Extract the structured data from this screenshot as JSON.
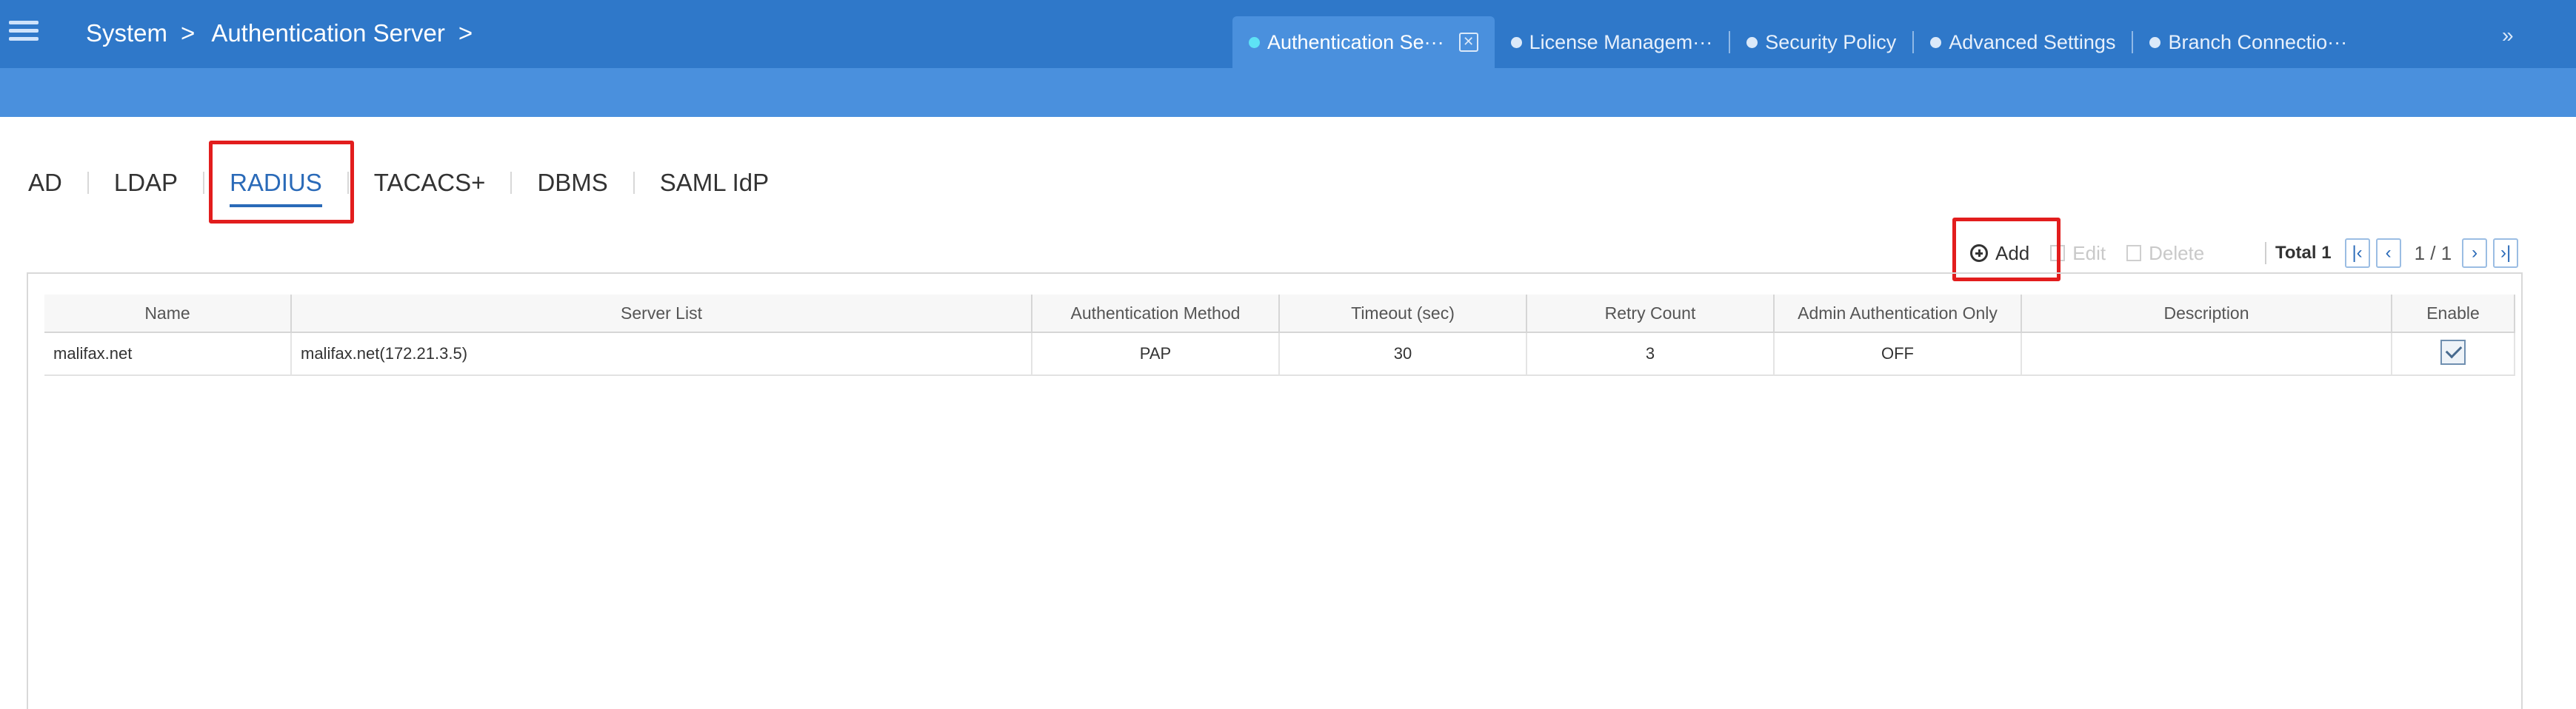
{
  "header": {
    "breadcrumb": [
      "System",
      ">",
      "Authentication Server",
      ">"
    ],
    "tabs": [
      {
        "label": "Authentication Se···",
        "active": true
      },
      {
        "label": "License Managem···",
        "active": false
      },
      {
        "label": "Security Policy",
        "active": false
      },
      {
        "label": "Advanced Settings",
        "active": false
      },
      {
        "label": "Branch Connectio···",
        "active": false
      }
    ],
    "more": "»"
  },
  "subtabs": [
    "AD",
    "LDAP",
    "RADIUS",
    "TACACS+",
    "DBMS",
    "SAML IdP"
  ],
  "selected_subtab": "RADIUS",
  "toolbar": {
    "add": "Add",
    "edit": "Edit",
    "delete": "Delete",
    "total": "Total 1",
    "page": "1 / 1"
  },
  "table": {
    "columns": [
      "Name",
      "Server List",
      "Authentication Method",
      "Timeout (sec)",
      "Retry Count",
      "Admin Authentication Only",
      "Description",
      "Enable"
    ],
    "rows": [
      {
        "name": "malifax.net",
        "server_list": "malifax.net(172.21.3.5)",
        "auth_method": "PAP",
        "timeout": "30",
        "retry": "3",
        "admin_only": "OFF",
        "description": "",
        "enable": true
      }
    ]
  },
  "colors": {
    "header": "#2f78c9",
    "subheader": "#4a90dd",
    "highlight": "#e21d1d",
    "accent": "#2a6ab8"
  }
}
